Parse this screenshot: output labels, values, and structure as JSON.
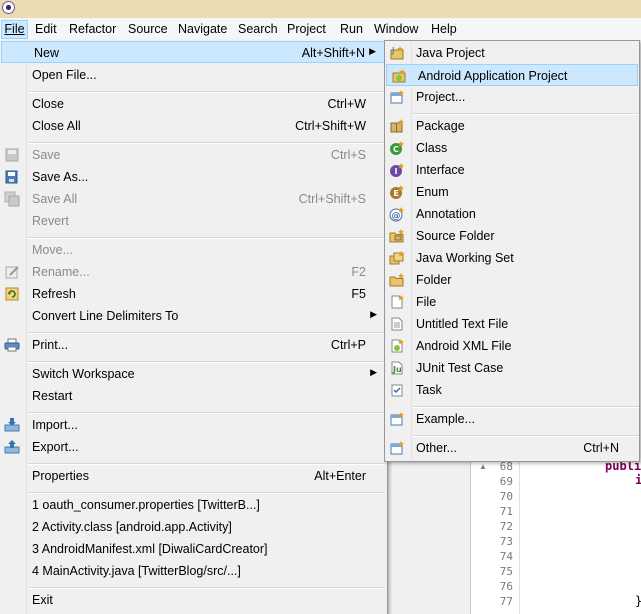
{
  "menubar": [
    "File",
    "Edit",
    "Refactor",
    "Source",
    "Navigate",
    "Search",
    "Project",
    "Run",
    "Window",
    "Help"
  ],
  "file_menu": {
    "new": {
      "label": "New",
      "accel": "Alt+Shift+N"
    },
    "open_file": {
      "label": "Open File..."
    },
    "close": {
      "label": "Close",
      "accel": "Ctrl+W"
    },
    "close_all": {
      "label": "Close All",
      "accel": "Ctrl+Shift+W"
    },
    "save": {
      "label": "Save",
      "accel": "Ctrl+S"
    },
    "save_as": {
      "label": "Save As..."
    },
    "save_all": {
      "label": "Save All",
      "accel": "Ctrl+Shift+S"
    },
    "revert": {
      "label": "Revert"
    },
    "move": {
      "label": "Move..."
    },
    "rename": {
      "label": "Rename...",
      "accel": "F2"
    },
    "refresh": {
      "label": "Refresh",
      "accel": "F5"
    },
    "convert": {
      "label": "Convert Line Delimiters To"
    },
    "print": {
      "label": "Print...",
      "accel": "Ctrl+P"
    },
    "switch_ws": {
      "label": "Switch Workspace"
    },
    "restart": {
      "label": "Restart"
    },
    "import": {
      "label": "Import..."
    },
    "export": {
      "label": "Export..."
    },
    "properties": {
      "label": "Properties",
      "accel": "Alt+Enter"
    },
    "recent": [
      "1 oauth_consumer.properties  [TwitterB...]",
      "2 Activity.class  [android.app.Activity]",
      "3 AndroidManifest.xml  [DiwaliCardCreator]",
      "4 MainActivity.java  [TwitterBlog/src/...]"
    ],
    "exit": {
      "label": "Exit"
    }
  },
  "new_submenu": {
    "items": [
      "Java Project",
      "Android Application Project",
      "Project...",
      "Package",
      "Class",
      "Interface",
      "Enum",
      "Annotation",
      "Source Folder",
      "Java Working Set",
      "Folder",
      "File",
      "Untitled Text File",
      "Android XML File",
      "JUnit Test Case",
      "Task",
      "Example...",
      "Other..."
    ],
    "other_accel": "Ctrl+N"
  },
  "editor": {
    "line_numbers": [
      "68",
      "69",
      "70",
      "71",
      "72",
      "73",
      "74",
      "75",
      "76",
      "77"
    ],
    "code_public": "publi",
    "code_i": "i",
    "brace": "}"
  }
}
